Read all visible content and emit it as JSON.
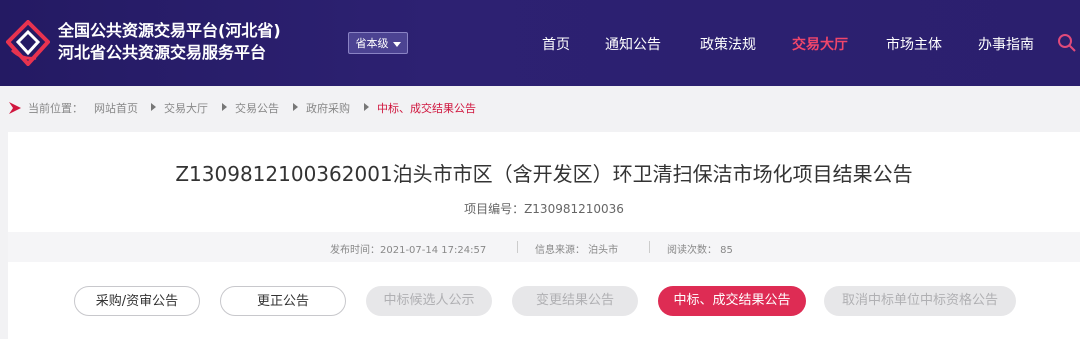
{
  "header": {
    "title_line1": "全国公共资源交易平台(河北省)",
    "title_line2": "河北省公共资源交易服务平台",
    "level_label": "省本级",
    "nav": [
      {
        "label": "首页",
        "active": false
      },
      {
        "label": "通知公告",
        "active": false
      },
      {
        "label": "政策法规",
        "active": false
      },
      {
        "label": "交易大厅",
        "active": true
      },
      {
        "label": "市场主体",
        "active": false
      },
      {
        "label": "办事指南",
        "active": false
      }
    ]
  },
  "breadcrumb": {
    "prefix": "当前位置：",
    "items": [
      "网站首页",
      "交易大厅",
      "交易公告",
      "政府采购",
      "中标、成交结果公告"
    ]
  },
  "notice": {
    "title": "Z1309812100362001泊头市市区（含开发区）环卫清扫保洁市场化项目结果公告",
    "project_no": "项目编号：Z130981210036",
    "publish_time": "发布时间：2021-07-14 17:24:57",
    "source": "信息来源：  泊头市",
    "views": "阅读次数：  85"
  },
  "tabs": [
    {
      "label": "采购/资审公告",
      "state": "normal"
    },
    {
      "label": "更正公告",
      "state": "normal"
    },
    {
      "label": "中标候选人公示",
      "state": "disabled"
    },
    {
      "label": "变更结果公告",
      "state": "disabled"
    },
    {
      "label": "中标、成交结果公告",
      "state": "active"
    },
    {
      "label": "取消中标单位中标资格公告",
      "state": "disabled"
    }
  ],
  "colors": {
    "header_bg": "#2b1f6e",
    "accent": "#de2c54",
    "active_nav": "#f0466b"
  }
}
